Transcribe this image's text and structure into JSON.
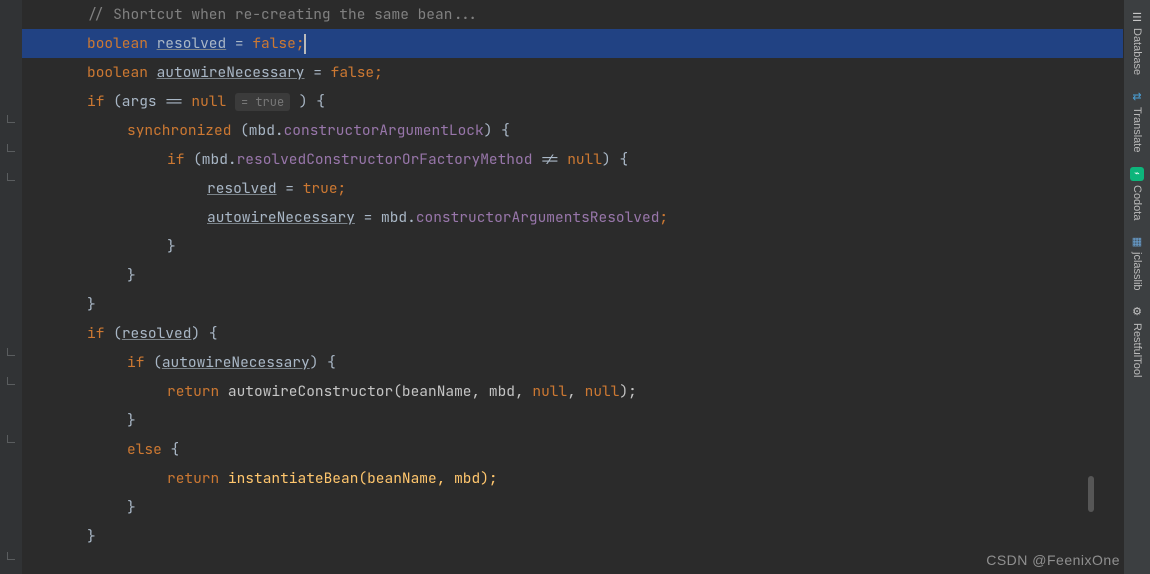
{
  "code": {
    "l0_comment": "// Shortcut when re-creating the same bean...",
    "l1_kw": "boolean ",
    "l1_var": "resolved",
    "l1_eq": " = ",
    "l1_val": "false",
    "l1_semi": ";",
    "l2_kw": "boolean ",
    "l2_var": "autowireNecessary",
    "l2_eq": " = ",
    "l2_val": "false",
    "l2_semi": ";",
    "l3_if": "if ",
    "l3_open": "(args == ",
    "l3_null": "null",
    "l3_hint": "= true",
    "l3_close": " ) {",
    "l4_sync": "synchronized ",
    "l4_open": "(mbd.",
    "l4_field": "constructorArgumentLock",
    "l4_close": ") {",
    "l5_if": "if ",
    "l5_open": "(mbd.",
    "l5_field": "resolvedConstructorOrFactoryMethod",
    "l5_neq": " != ",
    "l5_null": "null",
    "l5_close": ") {",
    "l6_var": "resolved",
    "l6_eq": " = ",
    "l6_val": "true",
    "l6_semi": ";",
    "l7_var": "autowireNecessary",
    "l7_eq": " = mbd.",
    "l7_field": "constructorArgumentsResolved",
    "l7_semi": ";",
    "l8_close": "}",
    "l9_close": "}",
    "l10_close": "}",
    "l11_if": "if ",
    "l11_open": "(",
    "l11_var": "resolved",
    "l11_close": ") {",
    "l12_if": "if ",
    "l12_open": "(",
    "l12_var": "autowireNecessary",
    "l12_close": ") {",
    "l13_ret": "return ",
    "l13_call": "autowireConstructor(beanName, mbd, ",
    "l13_n1": "null",
    "l13_c": ", ",
    "l13_n2": "null",
    "l13_close": ");",
    "l14_close": "}",
    "l15_else": "else ",
    "l15_open": "{",
    "l16_ret": "return ",
    "l16_call": "instantiateBean(beanName, mbd);",
    "l17_close": "}",
    "l18_close": "}"
  },
  "tools": {
    "t0": "Database",
    "t1": "Translate",
    "t2": "Codota",
    "t3": "jclasslib",
    "t4": "RestfulTool"
  },
  "watermark": "CSDN @FeenixOne"
}
